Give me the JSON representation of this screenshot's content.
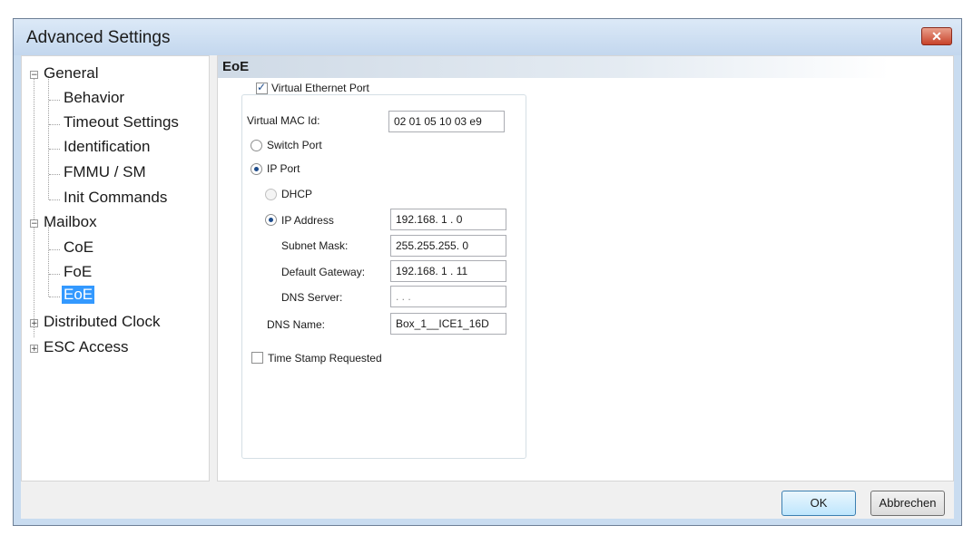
{
  "window": {
    "title": "Advanced Settings",
    "close_glyph": "✕"
  },
  "tree": {
    "general": {
      "label": "General",
      "children": [
        "Behavior",
        "Timeout Settings",
        "Identification",
        "FMMU / SM",
        "Init Commands"
      ]
    },
    "mailbox": {
      "label": "Mailbox",
      "children": [
        "CoE",
        "FoE",
        "EoE"
      ]
    },
    "distributed_clock": {
      "label": "Distributed Clock"
    },
    "esc_access": {
      "label": "ESC Access"
    },
    "collapse_glyph": "−",
    "expand_glyph": "+"
  },
  "eoe": {
    "title": "EoE",
    "virtual_ethernet_port": {
      "label": "Virtual Ethernet Port",
      "checked": true
    },
    "virtual_mac": {
      "label": "Virtual MAC Id:",
      "value": "02 01 05 10 03 e9"
    },
    "switch_port": {
      "label": "Switch Port",
      "checked": false
    },
    "ip_port": {
      "label": "IP Port",
      "checked": true
    },
    "dhcp": {
      "label": "DHCP",
      "checked": false
    },
    "ip_address": {
      "label": "IP Address",
      "checked": true,
      "value": "192.168.  1  .  0"
    },
    "subnet_mask": {
      "label": "Subnet Mask:",
      "value": "255.255.255.  0"
    },
    "default_gateway": {
      "label": "Default Gateway:",
      "value": "192.168.  1  . 11"
    },
    "dns_server": {
      "label": "DNS Server:",
      "value": "    .      .      ."
    },
    "dns_name": {
      "label": "DNS Name:",
      "value": "Box_1__ICE1_16D"
    },
    "time_stamp": {
      "label": "Time Stamp Requested",
      "checked": false
    }
  },
  "buttons": {
    "ok": "OK",
    "cancel": "Abbrechen"
  }
}
